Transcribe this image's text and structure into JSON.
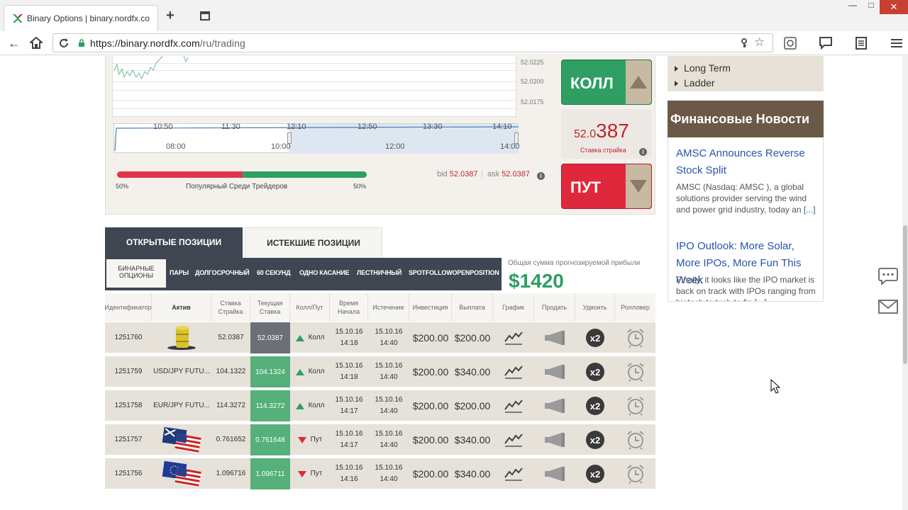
{
  "browser": {
    "tab_title": "Binary Options | binary.nordfx.co",
    "url_host": "https://binary.nordfx.com",
    "url_path": "/ru/trading"
  },
  "chart": {
    "y_labels": [
      "52.0225",
      "52.0200",
      "52.0175"
    ],
    "top_times": [
      "10:50",
      "11:30",
      "12:10",
      "12:50",
      "13:30",
      "14:10"
    ],
    "bottom_times": [
      "08:00",
      "10:00",
      "12:00",
      "14:00"
    ]
  },
  "sentiment": {
    "left_pct": "50%",
    "right_pct": "50%",
    "label": "Популярный Среди Трейдеров",
    "call_share": 0.5,
    "put_share": 0.5
  },
  "quotes": {
    "bid_label": "bid",
    "bid": "52.0387",
    "ask_label": "ask",
    "ask": "52.0387"
  },
  "trade": {
    "call_label": "КОЛЛ",
    "put_label": "ПУТ",
    "strike_prefix": "52.0",
    "strike_big": "387",
    "strike_label": "Ставка страйка"
  },
  "positions": {
    "tab_open": "ОТКРЫТЫЕ ПОЗИЦИИ",
    "tab_expired": "ИСТЕКШИЕ ПОЗИЦИИ",
    "filter_selected": "БИНАРНЫЕ ОПЦИОНЫ",
    "filters": [
      "ПАРЫ",
      "ДОЛГОСРОЧНЫЙ",
      "60 СЕКУНД",
      "ОДНО КАСАНИЕ",
      "ЛЕСТНИЧНЫЙ",
      "SPOTFOLLOWOPENPOSITION"
    ],
    "profit_label": "Общая сумма прогнозируемой прибыли",
    "profit_value": "$1420",
    "headers": [
      "Идентификатор",
      "Актив",
      "Ставка Страйка",
      "Текущая Ставка",
      "Колл/Пут",
      "Время Начала",
      "Истечение",
      "Инвестиция",
      "Выплата",
      "График",
      "Продать",
      "Удвоить",
      "Ролловер"
    ],
    "rows": [
      {
        "id": "1251760",
        "asset": "",
        "strike": "52.0387",
        "current": "52.0387",
        "dir": "Колл",
        "start_d": "15.10.16",
        "start_t": "14:18",
        "exp_d": "15.10.16",
        "exp_t": "14:40",
        "invest": "$200.00",
        "payout": "$200.00"
      },
      {
        "id": "1251759",
        "asset": "USD/JPY FUTU...",
        "strike": "104.1322",
        "current": "104.1324",
        "dir": "Колл",
        "start_d": "15.10.16",
        "start_t": "14:18",
        "exp_d": "15.10.16",
        "exp_t": "14:40",
        "invest": "$200.00",
        "payout": "$340.00"
      },
      {
        "id": "1251758",
        "asset": "EUR/JPY FUTU...",
        "strike": "114.3272",
        "current": "114.3272",
        "dir": "Колл",
        "start_d": "15.10.16",
        "start_t": "14:17",
        "exp_d": "15.10.16",
        "exp_t": "14:40",
        "invest": "$200.00",
        "payout": "$200.00"
      },
      {
        "id": "1251757",
        "asset": "",
        "strike": "0.761652",
        "current": "0.761648",
        "dir": "Пут",
        "start_d": "15.10.16",
        "start_t": "14:17",
        "exp_d": "15.10.16",
        "exp_t": "14:40",
        "invest": "$200.00",
        "payout": "$340.00"
      },
      {
        "id": "1251756",
        "asset": "",
        "strike": "1.096716",
        "current": "1.096711",
        "dir": "Пут",
        "start_d": "15.10.16",
        "start_t": "14:16",
        "exp_d": "15.10.16",
        "exp_t": "14:40",
        "invest": "$200.00",
        "payout": "$340.00"
      }
    ]
  },
  "sidebar": {
    "acc_items": [
      "Long Term",
      "Ladder"
    ],
    "news_header": "Финансовые Новости",
    "news": [
      {
        "title": "AMSC Announces Reverse Stock Split",
        "text": "AMSC (Nasdaq: AMSC ), a global solutions provider serving the wind and power grid industry, today an",
        "more": "[...]"
      },
      {
        "title": "IPO Outlook: More Solar, More IPOs, More Fun This Week",
        "text": "Finally, it looks like the IPO market is back on track with IPOs ranging from biotech to tech to fin",
        "more": "[...]"
      }
    ]
  },
  "colors": {
    "call_green": "#2e9e63",
    "put_red": "#e0283d",
    "dark_header": "#3f4652",
    "news_brown": "#6b5947"
  },
  "icons": [
    "chart-icon",
    "megaphone-icon",
    "double-icon",
    "alarm-clock-icon",
    "chat-icon",
    "mail-icon"
  ]
}
